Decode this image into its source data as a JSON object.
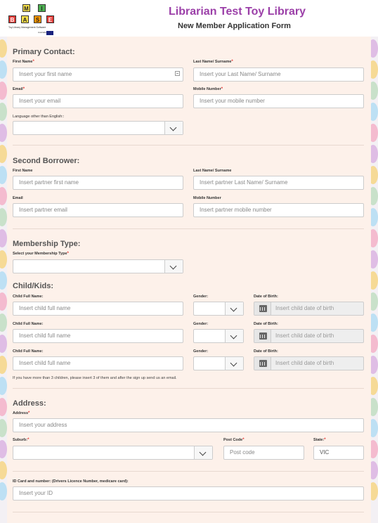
{
  "header": {
    "logo_letters": [
      "M",
      "I",
      "B",
      "A",
      "S",
      "E"
    ],
    "logo_tagline": "Toy Library Management Software",
    "logo_country": "Australia",
    "site_title": "Librarian Test Toy Library",
    "form_title": "New Member Application Form"
  },
  "primary_contact": {
    "title": "Primary Contact:",
    "first_name_label": "First Name",
    "first_name_placeholder": "Insert your first name",
    "last_name_label": "Last Name/ Surname",
    "last_name_placeholder": "Insert your Last Name/ Surname",
    "email_label": "Email",
    "email_placeholder": "Insert your email",
    "mobile_label": "Mobile Number",
    "mobile_placeholder": "Insert your mobile number",
    "language_label": "Language other than English::",
    "language_value": ""
  },
  "second_borrower": {
    "title": "Second Borrower:",
    "first_name_label": "First Name",
    "first_name_placeholder": "Insert partner first name",
    "last_name_label": "Last Name/ Surname",
    "last_name_placeholder": "Insert partner Last Name/ Surname",
    "email_label": "Email",
    "email_placeholder": "Insert partner email",
    "mobile_label": "Mobile Number",
    "mobile_placeholder": "Insert partner mobile number"
  },
  "membership": {
    "title": "Membership Type:",
    "select_label": "Select your Membership Type",
    "value": ""
  },
  "children": {
    "title": "Child/Kids:",
    "name_label": "Child Full Name:",
    "gender_label": "Gender:",
    "dob_label": "Date of Birth:",
    "name_placeholder": "Insert child full name",
    "dob_placeholder": "Insert child date of birth",
    "note": "If you have more than 3 children, please insert 3 of them and after the sign up send us an email."
  },
  "address": {
    "title": "Address:",
    "address_label": "Address",
    "address_placeholder": "Insert your address",
    "suburb_label": "Suburb:",
    "suburb_value": "",
    "postcode_label": "Post Code",
    "postcode_placeholder": "Post code",
    "state_label": "State:",
    "state_value": "VIC"
  },
  "id_card": {
    "label": "ID Card and number: (Drivers Licence Number, medicare card):",
    "placeholder": "Insert your ID"
  },
  "colors": {
    "brand_purple": "#9b3fa8",
    "required_red": "#e53935",
    "panel_bg": "#fdf1ea"
  }
}
